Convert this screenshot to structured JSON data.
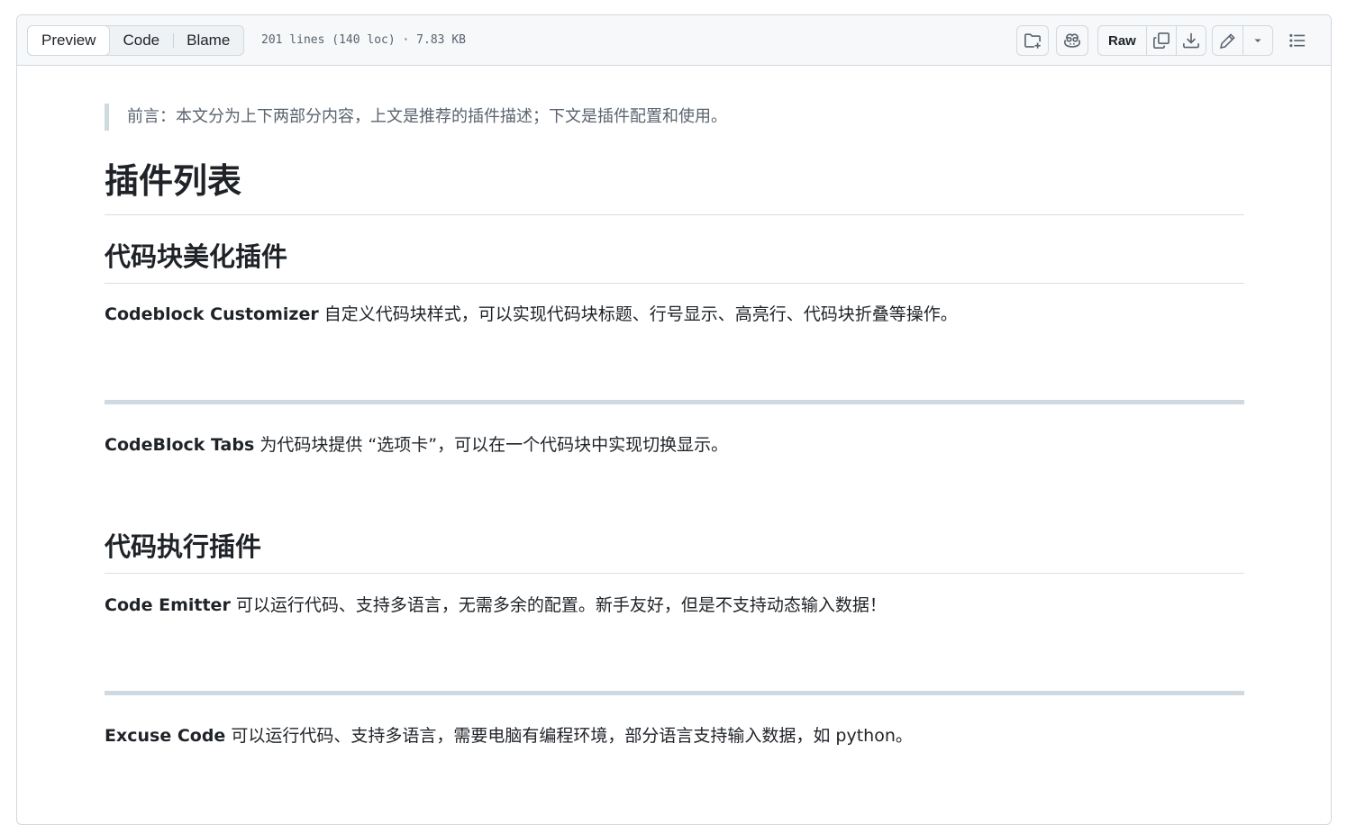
{
  "toolbar": {
    "tabs": [
      {
        "label": "Preview",
        "active": true
      },
      {
        "label": "Code",
        "active": false
      },
      {
        "label": "Blame",
        "active": false
      }
    ],
    "file_info": "201 lines (140 loc) · 7.83 KB",
    "raw_label": "Raw",
    "icons": [
      "add-file-icon",
      "copilot-icon",
      "copy-icon",
      "download-icon",
      "pencil-icon",
      "triangle-down-icon",
      "list-unordered-icon"
    ]
  },
  "article": {
    "quote": "前言：本文分为上下两部分内容，上文是推荐的插件描述；下文是插件配置和使用。",
    "h1": "插件列表",
    "section1": {
      "heading": "代码块美化插件",
      "item1_name": "Codeblock Customizer",
      "item1_desc": " 自定义代码块样式，可以实现代码块标题、行号显示、高亮行、代码块折叠等操作。",
      "item2_name": "CodeBlock Tabs",
      "item2_desc": " 为代码块提供 “选项卡”，可以在一个代码块中实现切换显示。"
    },
    "section2": {
      "heading": "代码执行插件",
      "item1_name": "Code Emitter",
      "item1_desc": " 可以运行代码、支持多语言，无需多余的配置。新手友好，但是不支持动态输入数据！",
      "item2_name": "Excuse Code",
      "item2_desc": " 可以运行代码、支持多语言，需要电脑有编程环境，部分语言支持输入数据，如 python。"
    }
  },
  "colors": {
    "border": "#d1d9e0",
    "header_bg": "#f6f8fa",
    "text": "#1f2328",
    "muted": "#59636e"
  }
}
